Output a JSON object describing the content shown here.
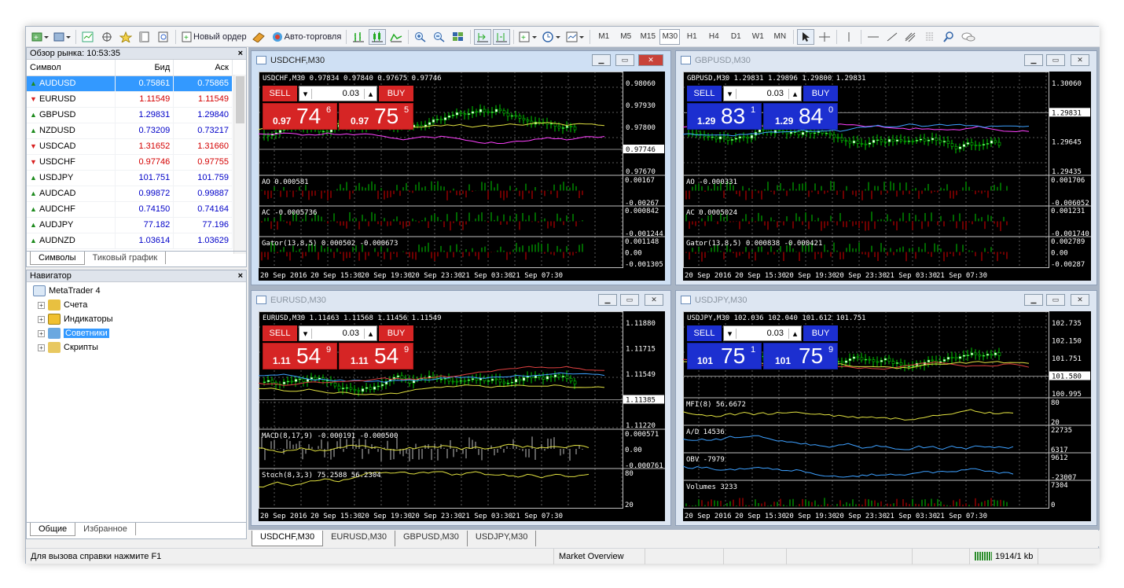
{
  "toolbar": {
    "new_order": "Новый ордер",
    "auto_trading": "Авто-торговля",
    "timeframes": [
      "M1",
      "M5",
      "M15",
      "M30",
      "H1",
      "H4",
      "D1",
      "W1",
      "MN"
    ],
    "active_tf": "M30"
  },
  "market_watch": {
    "title": "Обзор рынка: 10:53:35",
    "col_symbol": "Символ",
    "col_bid": "Бид",
    "col_ask": "Аск",
    "rows": [
      {
        "symbol": "AUDUSD",
        "bid": "0.75861",
        "ask": "0.75865",
        "dir": "up",
        "sel": true
      },
      {
        "symbol": "EURUSD",
        "bid": "1.11549",
        "ask": "1.11549",
        "dir": "dn"
      },
      {
        "symbol": "GBPUSD",
        "bid": "1.29831",
        "ask": "1.29840",
        "dir": "up"
      },
      {
        "symbol": "NZDUSD",
        "bid": "0.73209",
        "ask": "0.73217",
        "dir": "up"
      },
      {
        "symbol": "USDCAD",
        "bid": "1.31652",
        "ask": "1.31660",
        "dir": "dn"
      },
      {
        "symbol": "USDCHF",
        "bid": "0.97746",
        "ask": "0.97755",
        "dir": "dn"
      },
      {
        "symbol": "USDJPY",
        "bid": "101.751",
        "ask": "101.759",
        "dir": "up"
      },
      {
        "symbol": "AUDCAD",
        "bid": "0.99872",
        "ask": "0.99887",
        "dir": "up"
      },
      {
        "symbol": "AUDCHF",
        "bid": "0.74150",
        "ask": "0.74164",
        "dir": "up"
      },
      {
        "symbol": "AUDJPY",
        "bid": "77.182",
        "ask": "77.196",
        "dir": "up"
      },
      {
        "symbol": "AUDNZD",
        "bid": "1.03614",
        "ask": "1.03629",
        "dir": "up"
      }
    ],
    "tabs": [
      "Символы",
      "Тиковый график"
    ]
  },
  "navigator": {
    "title": "Навигатор",
    "root": "MetaTrader 4",
    "items": [
      "Счета",
      "Индикаторы",
      "Советники",
      "Скрипты"
    ],
    "tabs": [
      "Общие",
      "Избранное"
    ]
  },
  "charts": [
    {
      "title": "USDCHF,M30",
      "header": "USDCHF,M30  0.97834 0.97840 0.97675 0.97746",
      "sell_big": "74",
      "sell_pre": "0.97",
      "sell_sup": "6",
      "buy_big": "75",
      "buy_pre": "0.97",
      "buy_sup": "5",
      "lot": "0.03",
      "panel": "red",
      "prices": [
        "0.98060",
        "0.97930",
        "0.97800",
        "0.97746",
        "0.97670"
      ],
      "ind": [
        {
          "label": "AO 0.000581",
          "scale": [
            "0.00167",
            "-0.00267"
          ]
        },
        {
          "label": "AC -0.0005736",
          "scale": [
            "0.000842",
            "-0.001244"
          ]
        },
        {
          "label": "Gator(13,8,5) 0.000502 -0.000673",
          "scale": [
            "0.001148",
            "0.00",
            "-0.001305"
          ]
        }
      ],
      "times": [
        "20 Sep 2016",
        "20 Sep 15:30",
        "20 Sep 19:30",
        "20 Sep 23:30",
        "21 Sep 03:30",
        "21 Sep 07:30"
      ]
    },
    {
      "title": "GBPUSD,M30",
      "header": "GBPUSD,M30  1.29831 1.29896 1.29800 1.29831",
      "sell_big": "83",
      "sell_pre": "1.29",
      "sell_sup": "1",
      "buy_big": "84",
      "buy_pre": "1.29",
      "buy_sup": "0",
      "lot": "0.03",
      "panel": "blue",
      "prices": [
        "1.30060",
        "1.29831",
        "1.29645",
        "1.29435"
      ],
      "ind": [
        {
          "label": "AO -0.000331",
          "scale": [
            "0.001706",
            "-0.006052"
          ]
        },
        {
          "label": "AC 0.0005024",
          "scale": [
            "0.001231",
            "-0.001740"
          ]
        },
        {
          "label": "Gator(13,8,5) 0.000838 -0.000421",
          "scale": [
            "0.002789",
            "0.00",
            "-0.00287"
          ]
        }
      ],
      "times": [
        "20 Sep 2016",
        "20 Sep 15:30",
        "20 Sep 19:30",
        "20 Sep 23:30",
        "21 Sep 03:30",
        "21 Sep 07:30"
      ]
    },
    {
      "title": "EURUSD,M30",
      "header": "EURUSD,M30  1.11463 1.11568 1.11456 1.11549",
      "sell_big": "54",
      "sell_pre": "1.11",
      "sell_sup": "9",
      "buy_big": "54",
      "buy_pre": "1.11",
      "buy_sup": "9",
      "lot": "0.03",
      "panel": "red",
      "prices": [
        "1.11880",
        "1.11715",
        "1.11549",
        "1.11385",
        "1.11220"
      ],
      "ind": [
        {
          "label": "MACD(8,17,9) -0.000191 -0.000500",
          "scale": [
            "0.000571",
            "0.00",
            "-0.000761"
          ]
        },
        {
          "label": "Stoch(8,3,3) 75.2588 56.2304",
          "scale": [
            "80",
            "20"
          ]
        }
      ],
      "times": [
        "20 Sep 2016",
        "20 Sep 15:30",
        "20 Sep 19:30",
        "20 Sep 23:30",
        "21 Sep 03:30",
        "21 Sep 07:30"
      ]
    },
    {
      "title": "USDJPY,M30",
      "header": "USDJPY,M30  102.036 102.040 101.612 101.751",
      "sell_big": "75",
      "sell_pre": "101",
      "sell_sup": "1",
      "buy_big": "75",
      "buy_pre": "101",
      "buy_sup": "9",
      "lot": "0.03",
      "panel": "blue",
      "prices": [
        "102.735",
        "102.150",
        "101.751",
        "101.580",
        "100.995"
      ],
      "ind": [
        {
          "label": "MFI(8) 56.6672",
          "scale": [
            "80",
            "20"
          ]
        },
        {
          "label": "A/D 14536",
          "scale": [
            "22735",
            "6317"
          ]
        },
        {
          "label": "OBV -7979",
          "scale": [
            "9612",
            "-23007"
          ]
        },
        {
          "label": "Volumes 3233",
          "scale": [
            "7304",
            "0"
          ]
        }
      ],
      "times": [
        "20 Sep 2016",
        "20 Sep 15:30",
        "20 Sep 19:30",
        "20 Sep 23:30",
        "21 Sep 03:30",
        "21 Sep 07:30"
      ]
    }
  ],
  "chart_tabs": [
    "USDCHF,M30",
    "EURUSD,M30",
    "GBPUSD,M30",
    "USDJPY,M30"
  ],
  "buttons": {
    "sell": "SELL",
    "buy": "BUY"
  },
  "status": {
    "help": "Для вызова справки нажмите F1",
    "profile": "Market Overview",
    "traffic": "1914/1 kb"
  }
}
